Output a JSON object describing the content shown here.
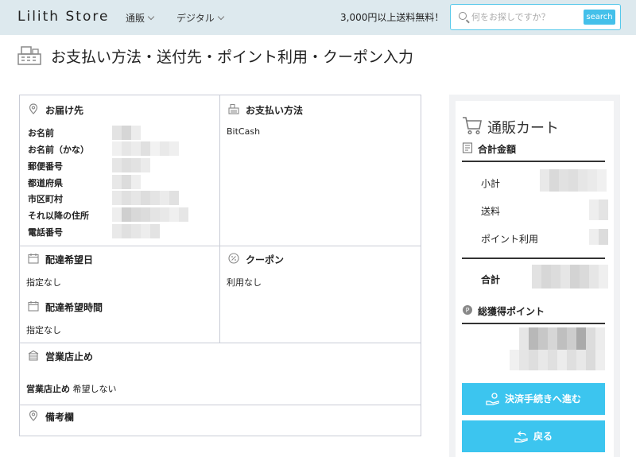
{
  "header": {
    "logo": "Lilith Store",
    "nav": [
      {
        "label": "通販"
      },
      {
        "label": "デジタル"
      }
    ],
    "shipping_note": "3,000円以上送料無料！",
    "search": {
      "placeholder": "何をお探しですか？",
      "value": "",
      "button_label": "search"
    }
  },
  "page": {
    "title": "お支払い方法・送付先・ポイント利用・クーポン入力"
  },
  "delivery": {
    "title": "お届け先",
    "fields": [
      {
        "label": "お名前"
      },
      {
        "label": "お名前（かな）"
      },
      {
        "label": "郵便番号"
      },
      {
        "label": "都道府県"
      },
      {
        "label": "市区町村"
      },
      {
        "label": "それ以降の住所"
      },
      {
        "label": "電話番号"
      }
    ]
  },
  "payment": {
    "title": "お支払い方法",
    "value": "BitCash"
  },
  "delivery_date": {
    "title": "配達希望日",
    "value": "指定なし"
  },
  "delivery_time": {
    "title": "配達希望時間",
    "value": "指定なし"
  },
  "coupon": {
    "title": "クーポン",
    "value": "利用なし"
  },
  "store_pickup": {
    "title": "営業店止め",
    "label": "営業店止め",
    "value": "希望しない"
  },
  "remarks": {
    "title": "備考欄"
  },
  "cart": {
    "title": "通販カート",
    "total_heading": "合計金額",
    "subtotal_label": "小計",
    "shipping_label": "送料",
    "points_label": "ポイント利用",
    "total_label": "合計",
    "earned_points_heading": "総獲得ポイント",
    "proceed_label": "決済手続きへ進む",
    "back_label": "戻る"
  },
  "colors": {
    "header_bg": "#dde9ee",
    "accent": "#3cc5ef",
    "border": "#c9ccd6"
  }
}
